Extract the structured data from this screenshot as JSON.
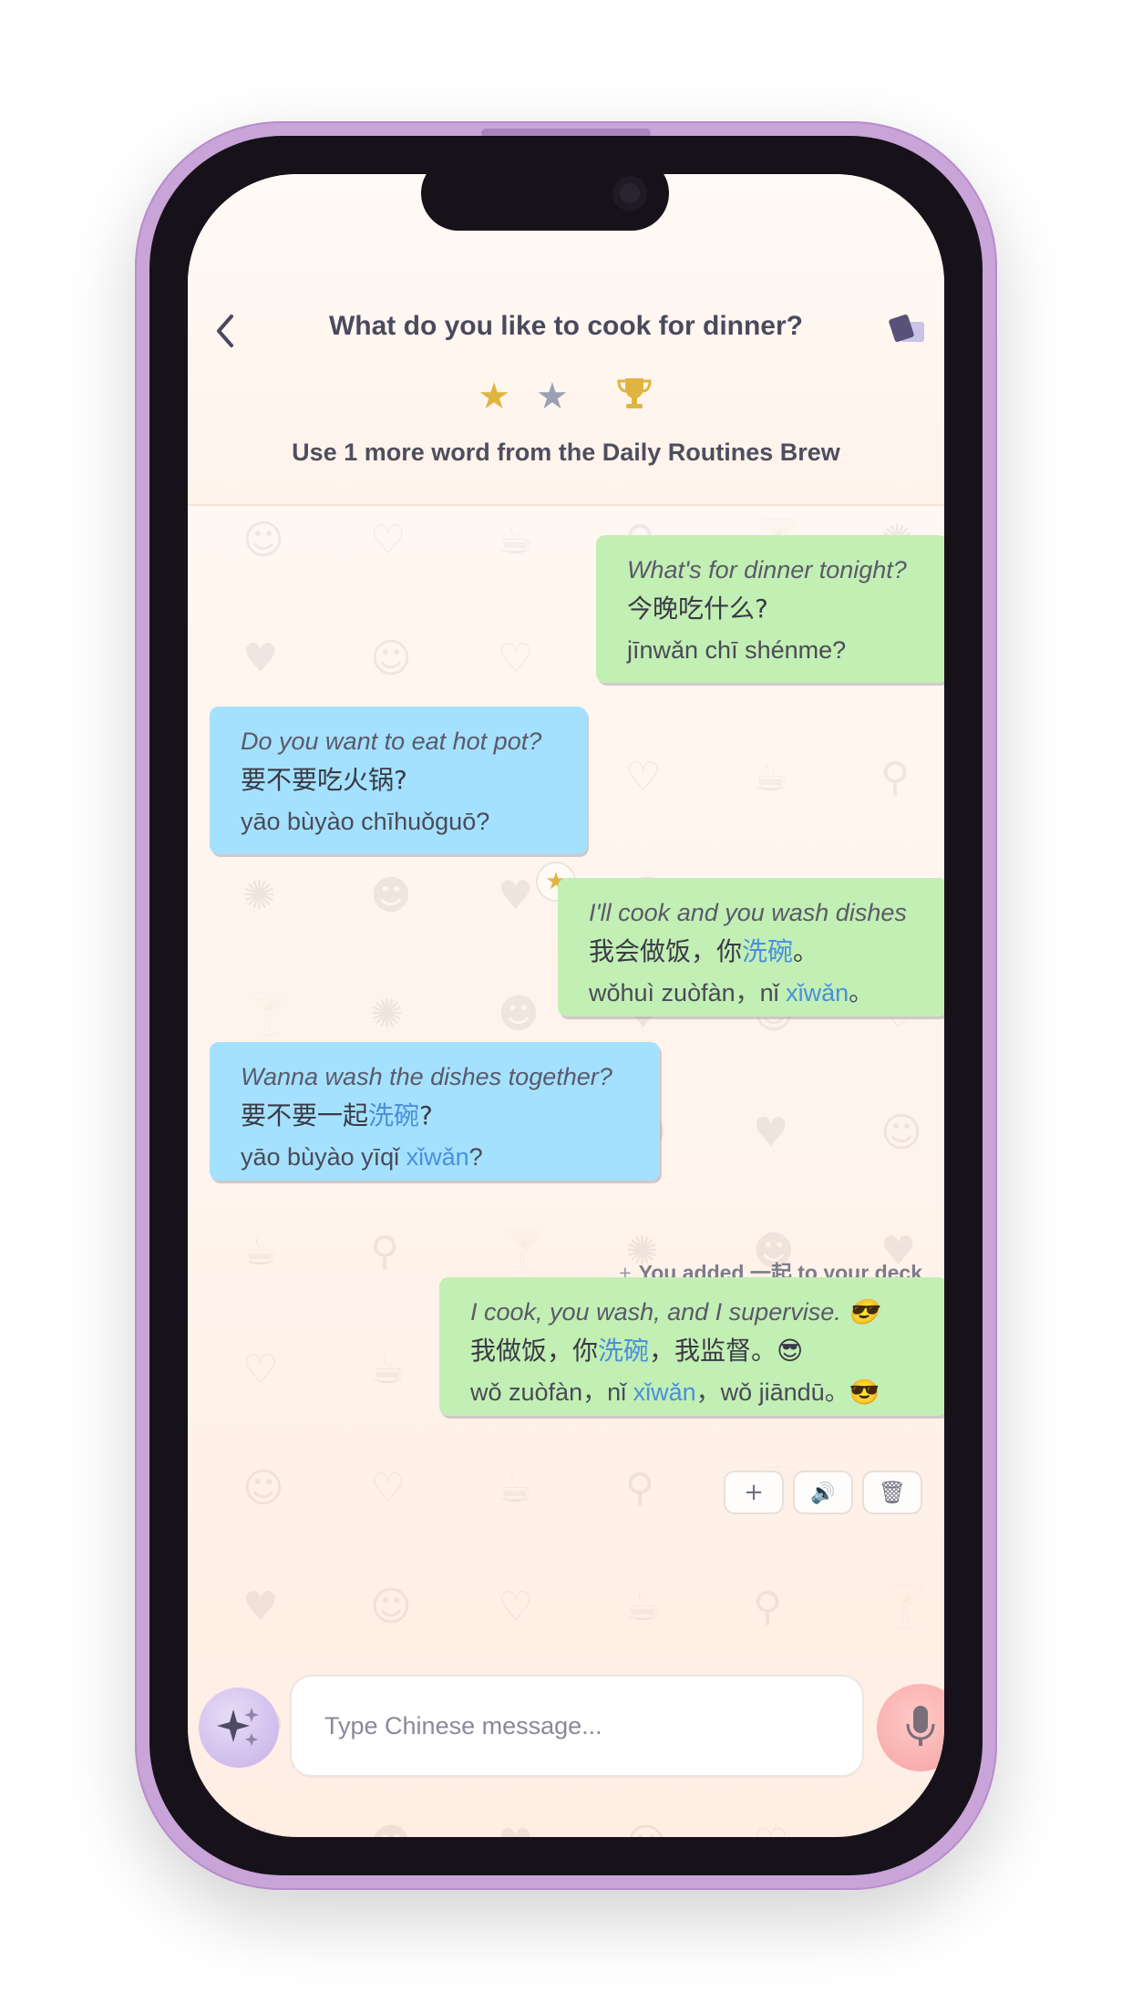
{
  "header": {
    "back_icon": "chevron-left-icon",
    "title": "What do you like to cook for dinner?",
    "deck_icon": "cards-icon",
    "stars": [
      {
        "icon": "star-icon",
        "state": "earned",
        "color": "#e0b441"
      },
      {
        "icon": "star-icon",
        "state": "unearned",
        "color": "#9aa1b3"
      },
      {
        "icon": "trophy-icon",
        "state": "goal",
        "color": "#e0b441"
      }
    ],
    "subtitle": "Use 1 more word from the Daily Routines Brew"
  },
  "messages": [
    {
      "side": "me",
      "english": "What's for dinner tonight?",
      "chinese": [
        {
          "t": "今晚吃什么?"
        }
      ],
      "pinyin": [
        {
          "t": "jīnwǎn chī shénme?"
        }
      ]
    },
    {
      "side": "them",
      "english": "Do you want to eat hot pot?",
      "chinese": [
        {
          "t": "要不要吃火锅?"
        }
      ],
      "pinyin": [
        {
          "t": "yāo bùyào chīhuǒguō?"
        }
      ]
    },
    {
      "side": "me",
      "starred": true,
      "english": "I'll cook and you wash dishes",
      "chinese": [
        {
          "t": "我会做饭，你"
        },
        {
          "t": "洗碗",
          "hl": true
        },
        {
          "t": "。"
        }
      ],
      "pinyin": [
        {
          "t": "wǒhuì zuòfàn，nǐ "
        },
        {
          "t": "xǐwǎn",
          "hl": true
        },
        {
          "t": "。"
        }
      ]
    },
    {
      "side": "them",
      "english": "Wanna wash the dishes together?",
      "chinese": [
        {
          "t": "要不要一起"
        },
        {
          "t": "洗碗",
          "hl": true
        },
        {
          "t": "?"
        }
      ],
      "pinyin": [
        {
          "t": "yāo bùyào yīqǐ "
        },
        {
          "t": "xǐwǎn",
          "hl": true
        },
        {
          "t": "?"
        }
      ]
    },
    {
      "side": "me",
      "english": "I cook, you wash, and I supervise. 😎",
      "chinese": [
        {
          "t": "我做饭，你"
        },
        {
          "t": "洗碗",
          "hl": true
        },
        {
          "t": "，我监督。😎"
        }
      ],
      "pinyin": [
        {
          "t": "wǒ zuòfàn，nǐ "
        },
        {
          "t": "xǐwǎn",
          "hl": true
        },
        {
          "t": "，wǒ jiāndū。😎"
        }
      ]
    }
  ],
  "deck_note": {
    "plus": "+",
    "text": "You added 一起 to your deck"
  },
  "message_actions": [
    {
      "name": "add-to-deck-button",
      "icon": "plus-icon",
      "glyph": "+"
    },
    {
      "name": "play-audio-button",
      "icon": "speaker-icon",
      "glyph": "🔊"
    },
    {
      "name": "delete-message-button",
      "icon": "trash-icon",
      "glyph": "🗑"
    }
  ],
  "composer": {
    "assist_icon": "sparkle-icon",
    "placeholder": "Type Chinese message...",
    "mic_icon": "microphone-icon"
  },
  "colors": {
    "my_bubble": "#c2efb4",
    "their_bubble": "#a4e1fe",
    "highlight": "#4b8fdc",
    "phone_frame": "#c9a4d8"
  }
}
